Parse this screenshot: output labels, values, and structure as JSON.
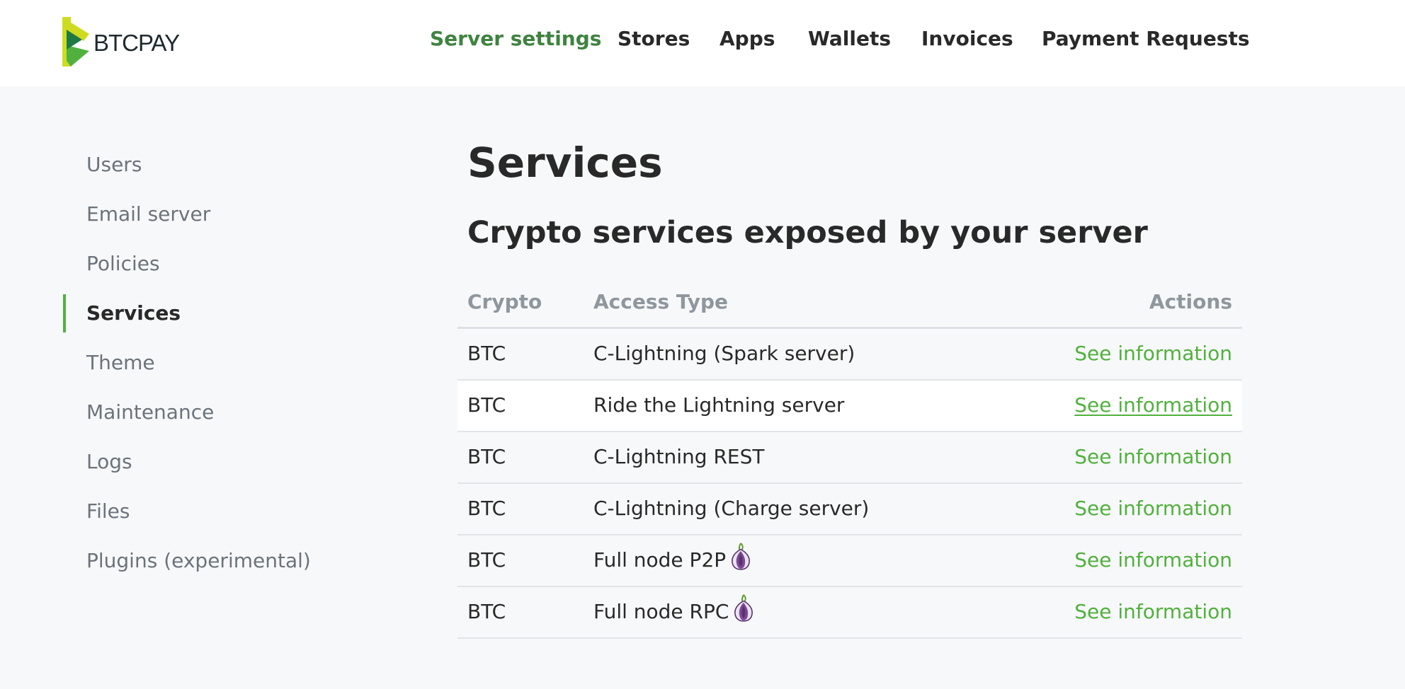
{
  "brand": {
    "logo_text": "BTCPAY"
  },
  "nav": {
    "items": [
      {
        "label": "Server settings",
        "active": true
      },
      {
        "label": "Stores"
      },
      {
        "label": "Apps"
      },
      {
        "label": "Wallets"
      },
      {
        "label": "Invoices"
      },
      {
        "label": "Payment Requests"
      }
    ]
  },
  "sidebar": {
    "items": [
      {
        "label": "Users"
      },
      {
        "label": "Email server"
      },
      {
        "label": "Policies"
      },
      {
        "label": "Services",
        "active": true
      },
      {
        "label": "Theme"
      },
      {
        "label": "Maintenance"
      },
      {
        "label": "Logs"
      },
      {
        "label": "Files"
      },
      {
        "label": "Plugins (experimental)"
      }
    ]
  },
  "main": {
    "title": "Services",
    "section_title": "Crypto services exposed by your server",
    "table": {
      "headers": {
        "crypto": "Crypto",
        "access_type": "Access Type",
        "actions": "Actions"
      },
      "rows": [
        {
          "crypto": "BTC",
          "access_type": "C-Lightning (Spark server)",
          "action": "See information",
          "tor": false
        },
        {
          "crypto": "BTC",
          "access_type": "Ride the Lightning server",
          "action": "See information",
          "tor": false
        },
        {
          "crypto": "BTC",
          "access_type": "C-Lightning REST",
          "action": "See information",
          "tor": false
        },
        {
          "crypto": "BTC",
          "access_type": "C-Lightning (Charge server)",
          "action": "See information",
          "tor": false
        },
        {
          "crypto": "BTC",
          "access_type": "Full node P2P",
          "action": "See information",
          "tor": true
        },
        {
          "crypto": "BTC",
          "access_type": "Full node RPC",
          "action": "See information",
          "tor": true
        }
      ]
    }
  },
  "colors": {
    "accent": "#51b13e",
    "active_nav": "#3f8340",
    "background": "#f7f8f9"
  }
}
